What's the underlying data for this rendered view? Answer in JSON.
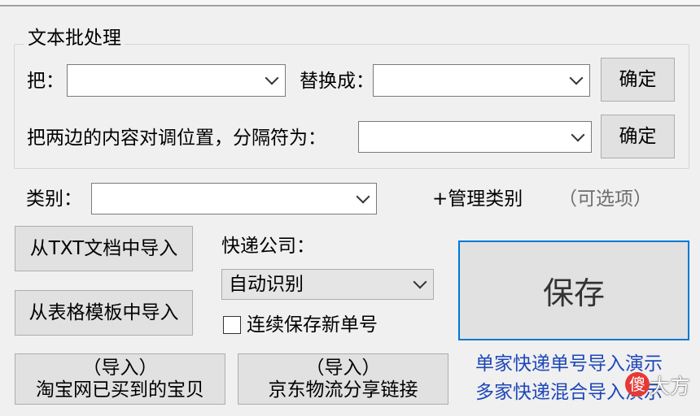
{
  "batch": {
    "group_title": "文本批处理",
    "replace_from_label": "把：",
    "replace_from_value": "",
    "replace_to_label": "替换成：",
    "replace_to_value": "",
    "confirm_label": "确定",
    "swap_label": "把两边的内容对调位置，分隔符为：",
    "swap_separator_value": "",
    "confirm2_label": "确定"
  },
  "category": {
    "label": "类别：",
    "value": "",
    "manage_label": "+管理类别",
    "optional_hint": "（可选项）"
  },
  "import": {
    "txt_label": "从TXT文档中导入",
    "table_label": "从表格模板中导入",
    "taobao_line1": "（导入）",
    "taobao_line2": "淘宝网已买到的宝贝",
    "jd_line1": "（导入）",
    "jd_line2": "京东物流分享链接"
  },
  "courier": {
    "label": "快递公司：",
    "selected": "自动识别",
    "continuous_label": "连续保存新单号",
    "continuous_checked": false
  },
  "save_label": "保存",
  "demo_links": {
    "single": "单家快递单号导入演示",
    "multi": "多家快递混合导入演示"
  },
  "watermark": {
    "icon_text": "傻",
    "text": "大方"
  }
}
